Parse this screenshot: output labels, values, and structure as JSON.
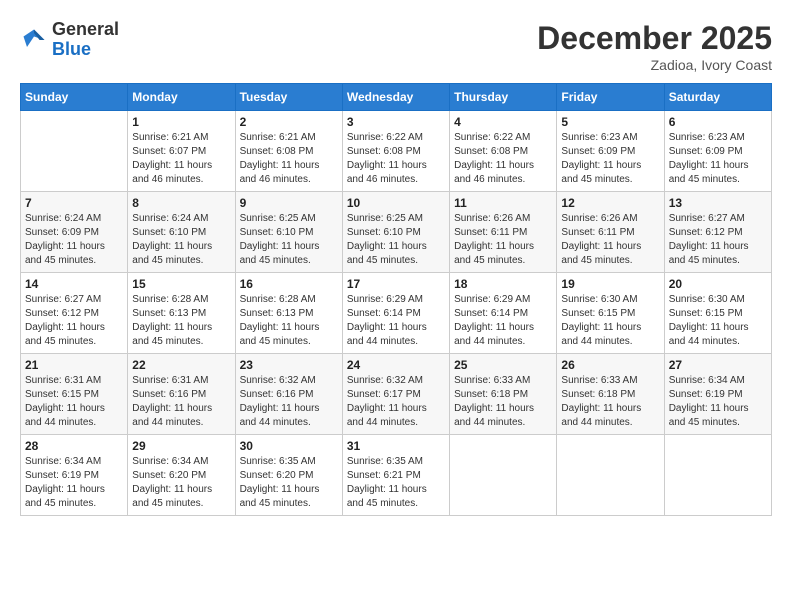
{
  "logo": {
    "general": "General",
    "blue": "Blue"
  },
  "header": {
    "month": "December 2025",
    "location": "Zadioa, Ivory Coast"
  },
  "weekdays": [
    "Sunday",
    "Monday",
    "Tuesday",
    "Wednesday",
    "Thursday",
    "Friday",
    "Saturday"
  ],
  "weeks": [
    [
      {
        "day": "",
        "info": ""
      },
      {
        "day": "1",
        "info": "Sunrise: 6:21 AM\nSunset: 6:07 PM\nDaylight: 11 hours\nand 46 minutes."
      },
      {
        "day": "2",
        "info": "Sunrise: 6:21 AM\nSunset: 6:08 PM\nDaylight: 11 hours\nand 46 minutes."
      },
      {
        "day": "3",
        "info": "Sunrise: 6:22 AM\nSunset: 6:08 PM\nDaylight: 11 hours\nand 46 minutes."
      },
      {
        "day": "4",
        "info": "Sunrise: 6:22 AM\nSunset: 6:08 PM\nDaylight: 11 hours\nand 46 minutes."
      },
      {
        "day": "5",
        "info": "Sunrise: 6:23 AM\nSunset: 6:09 PM\nDaylight: 11 hours\nand 45 minutes."
      },
      {
        "day": "6",
        "info": "Sunrise: 6:23 AM\nSunset: 6:09 PM\nDaylight: 11 hours\nand 45 minutes."
      }
    ],
    [
      {
        "day": "7",
        "info": "Sunrise: 6:24 AM\nSunset: 6:09 PM\nDaylight: 11 hours\nand 45 minutes."
      },
      {
        "day": "8",
        "info": "Sunrise: 6:24 AM\nSunset: 6:10 PM\nDaylight: 11 hours\nand 45 minutes."
      },
      {
        "day": "9",
        "info": "Sunrise: 6:25 AM\nSunset: 6:10 PM\nDaylight: 11 hours\nand 45 minutes."
      },
      {
        "day": "10",
        "info": "Sunrise: 6:25 AM\nSunset: 6:10 PM\nDaylight: 11 hours\nand 45 minutes."
      },
      {
        "day": "11",
        "info": "Sunrise: 6:26 AM\nSunset: 6:11 PM\nDaylight: 11 hours\nand 45 minutes."
      },
      {
        "day": "12",
        "info": "Sunrise: 6:26 AM\nSunset: 6:11 PM\nDaylight: 11 hours\nand 45 minutes."
      },
      {
        "day": "13",
        "info": "Sunrise: 6:27 AM\nSunset: 6:12 PM\nDaylight: 11 hours\nand 45 minutes."
      }
    ],
    [
      {
        "day": "14",
        "info": "Sunrise: 6:27 AM\nSunset: 6:12 PM\nDaylight: 11 hours\nand 45 minutes."
      },
      {
        "day": "15",
        "info": "Sunrise: 6:28 AM\nSunset: 6:13 PM\nDaylight: 11 hours\nand 45 minutes."
      },
      {
        "day": "16",
        "info": "Sunrise: 6:28 AM\nSunset: 6:13 PM\nDaylight: 11 hours\nand 45 minutes."
      },
      {
        "day": "17",
        "info": "Sunrise: 6:29 AM\nSunset: 6:14 PM\nDaylight: 11 hours\nand 44 minutes."
      },
      {
        "day": "18",
        "info": "Sunrise: 6:29 AM\nSunset: 6:14 PM\nDaylight: 11 hours\nand 44 minutes."
      },
      {
        "day": "19",
        "info": "Sunrise: 6:30 AM\nSunset: 6:15 PM\nDaylight: 11 hours\nand 44 minutes."
      },
      {
        "day": "20",
        "info": "Sunrise: 6:30 AM\nSunset: 6:15 PM\nDaylight: 11 hours\nand 44 minutes."
      }
    ],
    [
      {
        "day": "21",
        "info": "Sunrise: 6:31 AM\nSunset: 6:15 PM\nDaylight: 11 hours\nand 44 minutes."
      },
      {
        "day": "22",
        "info": "Sunrise: 6:31 AM\nSunset: 6:16 PM\nDaylight: 11 hours\nand 44 minutes."
      },
      {
        "day": "23",
        "info": "Sunrise: 6:32 AM\nSunset: 6:16 PM\nDaylight: 11 hours\nand 44 minutes."
      },
      {
        "day": "24",
        "info": "Sunrise: 6:32 AM\nSunset: 6:17 PM\nDaylight: 11 hours\nand 44 minutes."
      },
      {
        "day": "25",
        "info": "Sunrise: 6:33 AM\nSunset: 6:18 PM\nDaylight: 11 hours\nand 44 minutes."
      },
      {
        "day": "26",
        "info": "Sunrise: 6:33 AM\nSunset: 6:18 PM\nDaylight: 11 hours\nand 44 minutes."
      },
      {
        "day": "27",
        "info": "Sunrise: 6:34 AM\nSunset: 6:19 PM\nDaylight: 11 hours\nand 45 minutes."
      }
    ],
    [
      {
        "day": "28",
        "info": "Sunrise: 6:34 AM\nSunset: 6:19 PM\nDaylight: 11 hours\nand 45 minutes."
      },
      {
        "day": "29",
        "info": "Sunrise: 6:34 AM\nSunset: 6:20 PM\nDaylight: 11 hours\nand 45 minutes."
      },
      {
        "day": "30",
        "info": "Sunrise: 6:35 AM\nSunset: 6:20 PM\nDaylight: 11 hours\nand 45 minutes."
      },
      {
        "day": "31",
        "info": "Sunrise: 6:35 AM\nSunset: 6:21 PM\nDaylight: 11 hours\nand 45 minutes."
      },
      {
        "day": "",
        "info": ""
      },
      {
        "day": "",
        "info": ""
      },
      {
        "day": "",
        "info": ""
      }
    ]
  ]
}
